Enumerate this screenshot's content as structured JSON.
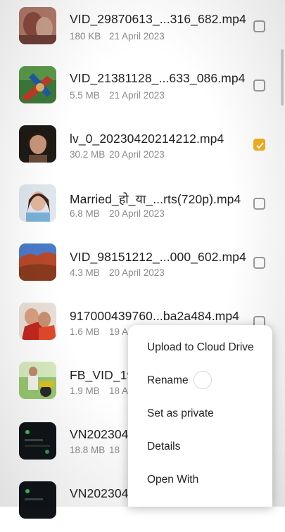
{
  "files": [
    {
      "name": "VID_29870613_...316_682.mp4",
      "size": "180 KB",
      "date": "21 April 2023",
      "checked": false,
      "thumb": "blurred-video-thumbnail"
    },
    {
      "name": "VID_21381128_...633_086.mp4",
      "size": "5.5 MB",
      "date": "21 April 2023",
      "checked": false,
      "thumb": "playground-slide-thumbnail"
    },
    {
      "name": "lv_0_20230420214212.mp4",
      "size": "30.2 MB",
      "date": "20 April 2023",
      "checked": true,
      "thumb": "woman-portrait-thumbnail"
    },
    {
      "name": "Married_हो_या_...rts(720p).mp4",
      "size": "6.8 MB",
      "date": "20 April 2023",
      "checked": false,
      "thumb": "woman-smiling-thumbnail"
    },
    {
      "name": "VID_98151212_...000_602.mp4",
      "size": "4.3 MB",
      "date": "20 April 2023",
      "checked": false,
      "thumb": "red-hills-landscape-thumbnail"
    },
    {
      "name": "917000439760...ba2a484.mp4",
      "size": "1.6 MB",
      "date": "19 A",
      "checked": false,
      "thumb": "couple-red-thumbnail"
    },
    {
      "name": "FB_VID_19",
      "size": "1.9 MB",
      "date": "18 A",
      "checked": false,
      "thumb": "man-motorcycle-thumbnail"
    },
    {
      "name": "VN202304",
      "size": "18.8 MB",
      "date": "18",
      "checked": false,
      "thumb": "dark-screen-thumbnail"
    },
    {
      "name": "VN202304",
      "size": "",
      "date": "",
      "checked": false,
      "thumb": "dark-screen-thumbnail"
    }
  ],
  "context_menu": {
    "items": [
      "Upload to Cloud Drive",
      "Rename",
      "Set as private",
      "Details",
      "Open With"
    ]
  },
  "colors": {
    "accent": "#f2b01e",
    "text": "#222222",
    "meta": "#8a8a8a"
  }
}
